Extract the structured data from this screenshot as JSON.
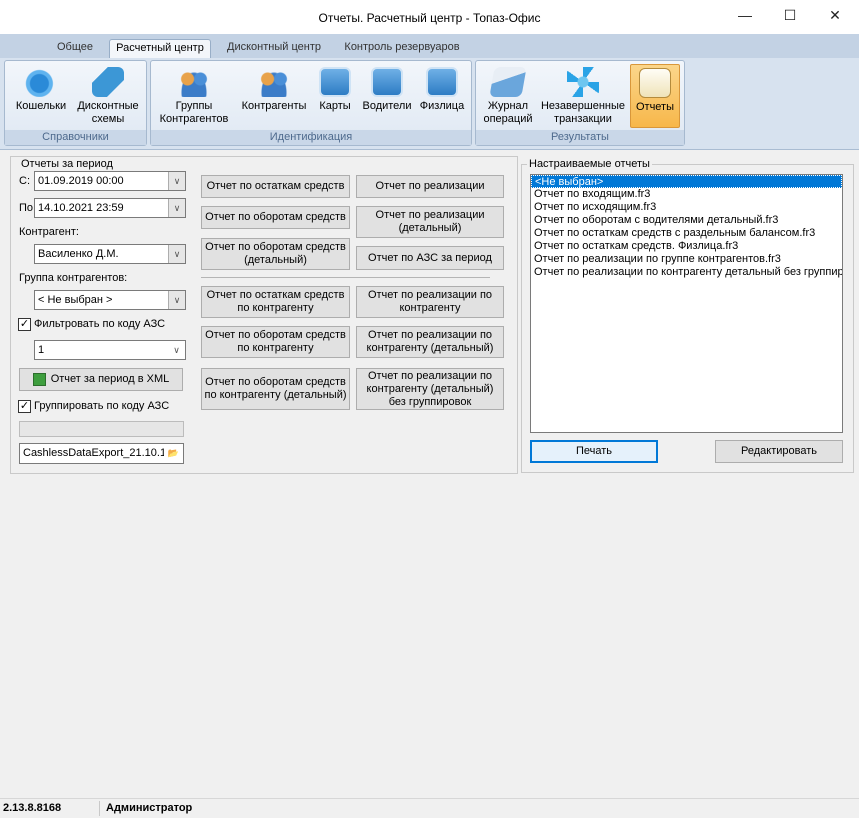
{
  "window": {
    "title": "Отчеты. Расчетный центр - Топаз-Офис",
    "min_icon": "minimize-icon",
    "max_icon": "maximize-icon",
    "close_icon": "close-icon"
  },
  "ribbon_tabs": [
    "Общее",
    "Расчетный центр",
    "Дисконтный центр",
    "Контроль резервуаров"
  ],
  "ribbon": {
    "groups": [
      {
        "label": "Справочники",
        "buttons": [
          {
            "label": "Кошельки",
            "icon": "wallet-icon"
          },
          {
            "label": "Дисконтные\nсхемы",
            "icon": "discount-card-icon"
          }
        ]
      },
      {
        "label": "Идентификация",
        "buttons": [
          {
            "label": "Группы\nКонтрагентов",
            "icon": "group-icon"
          },
          {
            "label": "Контрагенты",
            "icon": "people-icon"
          },
          {
            "label": "Карты",
            "icon": "cards-icon"
          },
          {
            "label": "Водители",
            "icon": "driver-icon"
          },
          {
            "label": "Физлица",
            "icon": "person-card-icon"
          }
        ]
      },
      {
        "label": "Результаты",
        "buttons": [
          {
            "label": "Журнал\nопераций",
            "icon": "journal-icon"
          },
          {
            "label": "Незавершенные\nтранзакции",
            "icon": "snowflake-icon"
          },
          {
            "label": "Отчеты",
            "icon": "reports-icon"
          }
        ]
      }
    ]
  },
  "period": {
    "legend": "Отчеты за период",
    "from_label": "С:",
    "from_value": "01.09.2019 00:00",
    "to_label": "По:",
    "to_value": "14.10.2021 23:59",
    "contractor_label": "Контрагент:",
    "contractor_value": "Василенко Д.М.",
    "group_label": "Группа контрагентов:",
    "group_value": "< Не выбран >",
    "filter_checked": "✓",
    "filter_label": "Фильтровать по коду АЗС",
    "azs_code_value": "1",
    "xml_button": "Отчет за период в XML",
    "group_checked": "✓",
    "group_by_label": "Группировать по коду АЗС",
    "export_file_value": "CashlessDataExport_21.10.1",
    "progress_value": 0
  },
  "report_buttons": {
    "left": [
      "Отчет по остаткам средств",
      "Отчет по оборотам средств",
      "Отчет по оборотам средств\n(детальный)",
      "Отчет по остаткам средств\nпо контрагенту",
      "Отчет по оборотам средств\nпо контрагенту",
      "Отчет по оборотам средств\nпо контрагенту (детальный)"
    ],
    "right": [
      "Отчет по реализации",
      "Отчет по реализации\n(детальный)",
      "Отчет по АЗС за период",
      "Отчет по реализации по\nконтрагенту",
      "Отчет по реализации по\nконтрагенту (детальный)",
      "Отчет по реализации по\nконтрагенту (детальный)\nбез группировок"
    ]
  },
  "custom_reports": {
    "legend": "Настраиваемые отчеты",
    "items": [
      "<Не выбран>",
      "Отчет по входящим.fr3",
      "Отчет по исходящим.fr3",
      "Отчет по оборотам с водителями детальный.fr3",
      "Отчет по остаткам средств с раздельным балансом.fr3",
      "Отчет по остаткам средств. Физлица.fr3",
      "Отчет по реализации по группе контрагентов.fr3",
      "Отчет по реализации по контрагенту детальный без группир"
    ],
    "selected_index": 0,
    "print_button": "Печать",
    "edit_button": "Редактировать"
  },
  "status": {
    "version": "2.13.8.8168",
    "user": "Администратор"
  }
}
